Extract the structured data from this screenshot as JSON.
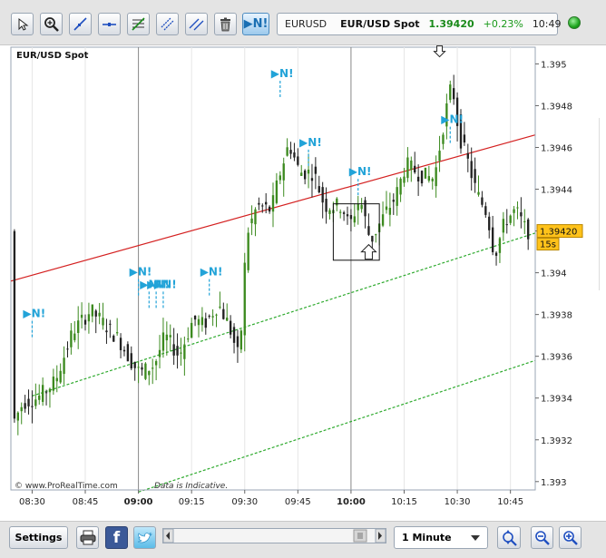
{
  "toolbar": {
    "tools": [
      "pointer-icon",
      "zoom-cursor-icon",
      "trendline-icon",
      "horizontal-line-icon",
      "fibonacci-icon",
      "channel-icon",
      "parallel-lines-icon",
      "trash-icon"
    ],
    "news_button": "▶N!"
  },
  "quote": {
    "code": "EURUSD",
    "name": "EUR/USD Spot",
    "price": "1.39420",
    "change": "+0.23%",
    "time": "10:49",
    "price_color": "#1a9a1a"
  },
  "chart_data": {
    "type": "candlestick",
    "title": "EUR/USD Spot",
    "watermark": "www.ProRealTime.com",
    "disclaimer": "Data is Indicative.",
    "x_ticks": [
      "08:30",
      "08:45",
      "09:00",
      "09:15",
      "09:30",
      "09:45",
      "10:00",
      "10:15",
      "10:30",
      "10:45"
    ],
    "x_ticks_bold": [
      "09:00",
      "10:00"
    ],
    "y_ticks": [
      "1.393",
      "1.3932",
      "1.3934",
      "1.3936",
      "1.3938",
      "1.394",
      "1.3942",
      "1.3944",
      "1.3946",
      "1.3948",
      "1.395"
    ],
    "ylim": [
      1.39296,
      1.39508
    ],
    "x_range": [
      "08:24",
      "10:52"
    ],
    "last_price": "1.39420",
    "countdown": "15s",
    "trend_lines": [
      {
        "kind": "resistance",
        "color": "#d42020",
        "start": [
          "08:24",
          1.39396
        ],
        "end": [
          "10:52",
          1.39466
        ]
      },
      {
        "kind": "channel",
        "color": "#2eaa2e",
        "start": [
          "08:30",
          1.39341
        ],
        "end": [
          "10:52",
          1.39419
        ]
      },
      {
        "kind": "channel",
        "color": "#2eaa2e",
        "start": [
          "09:00",
          1.39295
        ],
        "end": [
          "10:52",
          1.39358
        ]
      }
    ],
    "news_markers": [
      {
        "time": "08:30",
        "price": 1.3937
      },
      {
        "time": "09:00",
        "price": 1.3939
      },
      {
        "time": "09:03",
        "price": 1.39384
      },
      {
        "time": "09:05",
        "price": 1.39384
      },
      {
        "time": "09:07",
        "price": 1.39384
      },
      {
        "time": "09:20",
        "price": 1.3939
      },
      {
        "time": "09:40",
        "price": 1.39485
      },
      {
        "time": "09:48",
        "price": 1.39452
      },
      {
        "time": "10:02",
        "price": 1.39438
      },
      {
        "time": "10:28",
        "price": 1.39463
      }
    ],
    "marker_label": "▶N!",
    "highlight_box": {
      "start": "09:55",
      "end": "10:08",
      "low": 1.39406,
      "high": 1.39433
    },
    "arrows": [
      {
        "direction": "down",
        "time": "10:25",
        "price": 1.39506
      },
      {
        "direction": "up",
        "time": "10:05",
        "price": 1.3941
      }
    ]
  },
  "bottom": {
    "settings": "Settings",
    "interval": "1 Minute",
    "buttons": [
      "print-icon",
      "facebook-icon",
      "twitter-icon"
    ],
    "zoom": [
      "zoom-out-icon",
      "zoom-in-icon"
    ]
  }
}
